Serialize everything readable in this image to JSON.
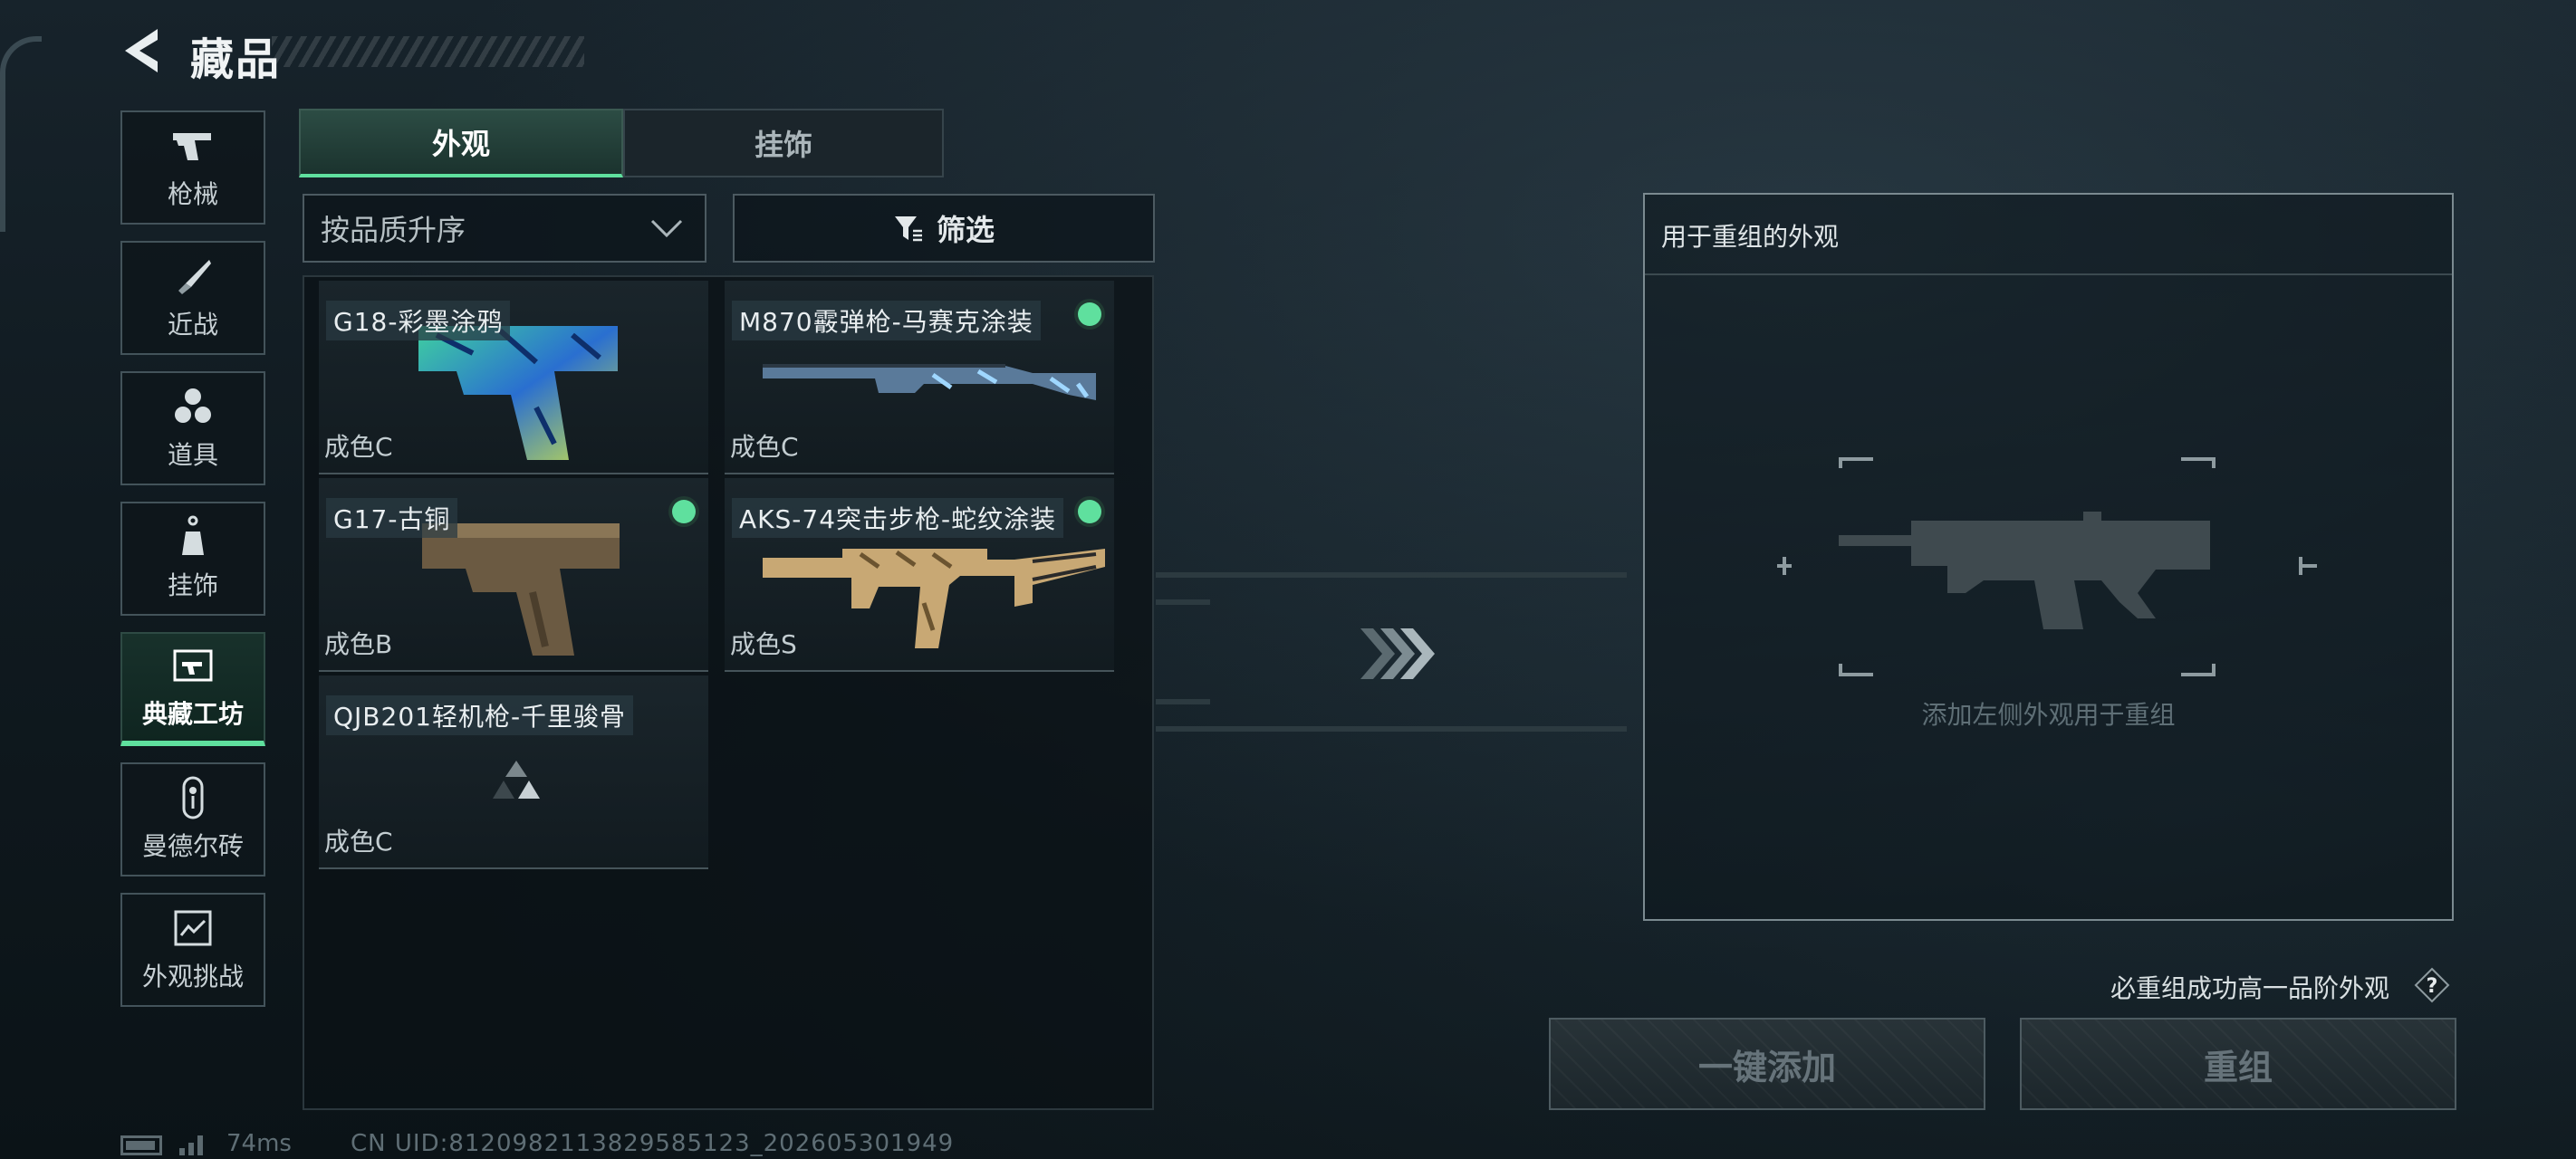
{
  "header": {
    "title": "藏品"
  },
  "sidebar": {
    "items": [
      {
        "label": "枪械",
        "icon": "pistol-icon"
      },
      {
        "label": "近战",
        "icon": "knife-icon"
      },
      {
        "label": "道具",
        "icon": "grenade-icon"
      },
      {
        "label": "挂饰",
        "icon": "charm-icon"
      },
      {
        "label": "典藏工坊",
        "icon": "workshop-icon",
        "active": true
      },
      {
        "label": "曼德尔砖",
        "icon": "brick-icon"
      },
      {
        "label": "外观挑战",
        "icon": "challenge-icon"
      }
    ]
  },
  "tabs": [
    {
      "label": "外观",
      "active": true
    },
    {
      "label": "挂饰",
      "active": false
    }
  ],
  "sort": {
    "value": "按品质升序"
  },
  "filter": {
    "label": "筛选"
  },
  "items": [
    {
      "name": "G18-彩墨涂鸦",
      "grade": "成色C",
      "equipped": false,
      "art": "g18-pistol-art"
    },
    {
      "name": "M870霰弹枪-马赛克涂装",
      "grade": "成色C",
      "equipped": true,
      "art": "m870-shotgun-art"
    },
    {
      "name": "G17-古铜",
      "grade": "成色B",
      "equipped": true,
      "art": "g17-pistol-art"
    },
    {
      "name": "AKS-74突击步枪-蛇纹涂装",
      "grade": "成色S",
      "equipped": true,
      "art": "aks74-rifle-art"
    },
    {
      "name": "QJB201轻机枪-千里骏骨",
      "grade": "成色C",
      "equipped": false,
      "art": "placeholder-triangle"
    }
  ],
  "recombine": {
    "title": "用于重组的外观",
    "hint": "添加左侧外观用于重组",
    "guarantee": "必重组成功高一品阶外观",
    "help_icon": "?",
    "add_button": "一键添加",
    "recombine_button": "重组"
  },
  "footer": {
    "ping": "74ms",
    "uid": "CN UID:8120982113829585123_202605301949"
  },
  "colors": {
    "accent": "#5fe09e",
    "panel_border": "#4c5a61",
    "background": "#101a20"
  }
}
